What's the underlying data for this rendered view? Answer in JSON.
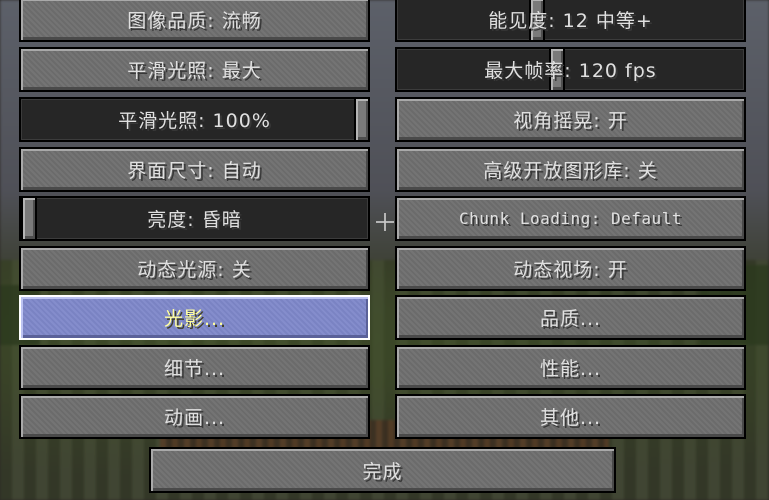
{
  "left_column": [
    {
      "id": "graphics",
      "label": "图像品质: 流畅",
      "kind": "button"
    },
    {
      "id": "smooth-lighting",
      "label": "平滑光照: 最大",
      "kind": "button"
    },
    {
      "id": "smooth-lighting-level",
      "label": "平滑光照: 100%",
      "kind": "slider",
      "level_fraction": 1.0
    },
    {
      "id": "gui-scale",
      "label": "界面尺寸: 自动",
      "kind": "button"
    },
    {
      "id": "brightness",
      "label": "亮度: 昏暗",
      "kind": "slider",
      "level_fraction": 0.0
    },
    {
      "id": "dynamic-lights",
      "label": "动态光源: 关",
      "kind": "button"
    },
    {
      "id": "shaders",
      "label": "光影...",
      "kind": "button",
      "hovered": true
    },
    {
      "id": "details",
      "label": "细节...",
      "kind": "button"
    },
    {
      "id": "animations",
      "label": "动画...",
      "kind": "button"
    }
  ],
  "right_column": [
    {
      "id": "render-distance",
      "label": "能见度: 12 中等+",
      "kind": "slider",
      "level_fraction": 0.4
    },
    {
      "id": "max-framerate",
      "label": "最大帧率: 120 fps",
      "kind": "slider",
      "level_fraction": 0.46
    },
    {
      "id": "view-bobbing",
      "label": "视角摇晃: 开",
      "kind": "button"
    },
    {
      "id": "advanced-opengl",
      "label": "高级开放图形库: 关",
      "kind": "button"
    },
    {
      "id": "chunk-loading",
      "label": "Chunk Loading: Default",
      "kind": "button"
    },
    {
      "id": "dynamic-fov",
      "label": "动态视场: 开",
      "kind": "button"
    },
    {
      "id": "quality",
      "label": "品质...",
      "kind": "button"
    },
    {
      "id": "performance",
      "label": "性能...",
      "kind": "button"
    },
    {
      "id": "other",
      "label": "其他...",
      "kind": "button"
    }
  ],
  "done_button": {
    "label": "完成"
  }
}
